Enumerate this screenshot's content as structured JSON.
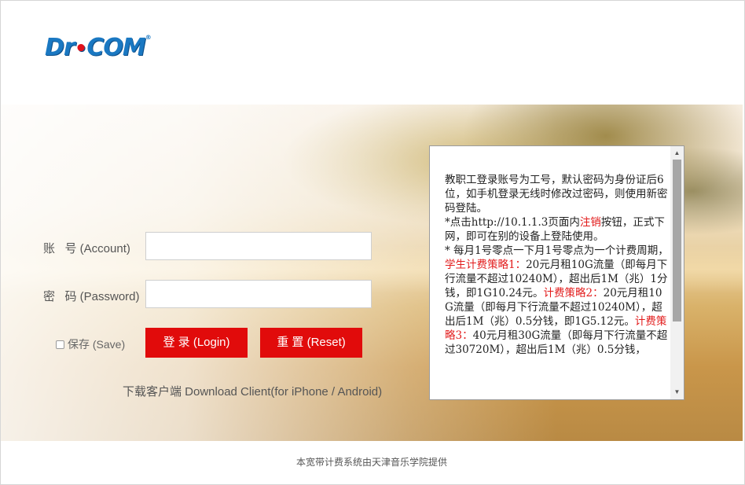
{
  "header": {
    "logo_main": "Dr",
    "logo_dot": "•",
    "logo_tail": "COM",
    "logo_reg": "®"
  },
  "login": {
    "account_label": "账   号 (Account)",
    "password_label": "密   码 (Password)",
    "account_value": "",
    "password_value": "",
    "save_label": "保存 (Save)",
    "login_button": "登 录 (Login)",
    "reset_button": "重 置 (Reset)",
    "download_text": "下载客户端 Download Client(for iPhone / Android)"
  },
  "notice": {
    "lines": [
      {
        "t": "教职工登录账号为工号，默认密码为身份证后6位，如手机登录无线时修改过密码，则使用新密码登陆。",
        "red": false
      },
      {
        "br": true
      },
      {
        "t": "*点击http://10.1.1.3页面内",
        "red": false
      },
      {
        "t": "注销",
        "red": true
      },
      {
        "t": "按钮，正式下网，即可在别的设备上登陆使用。",
        "red": false
      },
      {
        "br": true
      },
      {
        "t": "* 每月1号零点一下月1号零点为一个计费周期，",
        "red": false
      },
      {
        "t": "学生计费策略1：",
        "red": true
      },
      {
        "t": "20元月租10G流量（即每月下行流量不超过10240M），超出后1M（兆）1分钱，即1G10.24元。",
        "red": false
      },
      {
        "t": "计费策略2：",
        "red": true
      },
      {
        "t": "20元月租10G流量（即每月下行流量不超过10240M），超出后1M（兆）0.5分钱，即1G5.12元。",
        "red": false
      },
      {
        "t": "计费策略3：",
        "red": true
      },
      {
        "t": "40元月租30G流量（即每月下行流量不超过30720M），超出后1M（兆）0.5分钱，",
        "red": false
      }
    ],
    "scroll_up": "▲",
    "scroll_down": "▼"
  },
  "footer": {
    "text": "本宽带计费系统由天津音乐学院提供"
  },
  "colors": {
    "accent_red": "#e10b0b",
    "notice_red": "#e21b1b",
    "logo_blue": "#1a78c2"
  }
}
